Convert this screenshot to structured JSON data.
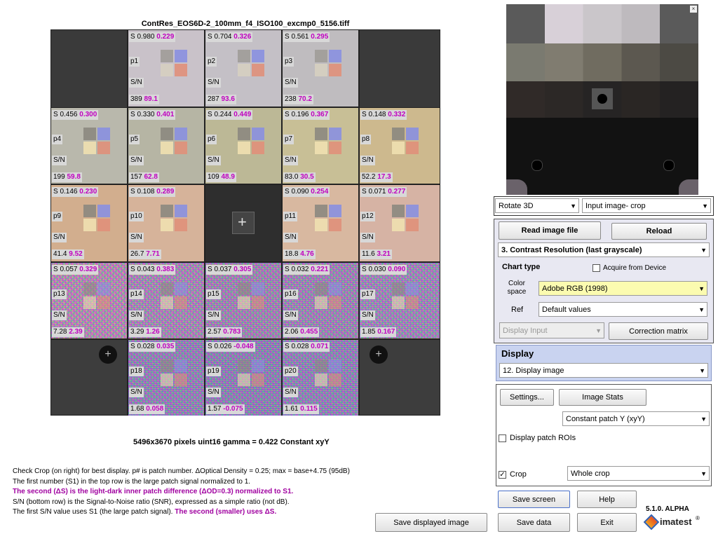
{
  "chart": {
    "title": "ContRes_EOS6D-2_100mm_f4_ISO100_excmp0_5156.tiff",
    "patches": [
      {
        "id": "p1",
        "s1": "S 0.980",
        "s2": "0.229",
        "sn1": "389",
        "sn2": "89.1",
        "col": 1,
        "row": 0,
        "bg": "#c9c2c9"
      },
      {
        "id": "p2",
        "s1": "S 0.704",
        "s2": "0.326",
        "sn1": "287",
        "sn2": "93.6",
        "col": 2,
        "row": 0,
        "bg": "#c4c0c6"
      },
      {
        "id": "p3",
        "s1": "S 0.561",
        "s2": "0.295",
        "sn1": "238",
        "sn2": "70.2",
        "col": 3,
        "row": 0,
        "bg": "#bfbcbf"
      },
      {
        "id": "p4",
        "s1": "S 0.456",
        "s2": "0.300",
        "sn1": "199",
        "sn2": "59.8",
        "col": 0,
        "row": 1,
        "bg": "#b9b8ac"
      },
      {
        "id": "p5",
        "s1": "S 0.330",
        "s2": "0.401",
        "sn1": "157",
        "sn2": "62.8",
        "col": 1,
        "row": 1,
        "bg": "#b6b5a4"
      },
      {
        "id": "p6",
        "s1": "S 0.244",
        "s2": "0.449",
        "sn1": "109",
        "sn2": "48.9",
        "col": 2,
        "row": 1,
        "bg": "#bcb896"
      },
      {
        "id": "p7",
        "s1": "S 0.196",
        "s2": "0.367",
        "sn1": "83.0",
        "sn2": "30.5",
        "col": 3,
        "row": 1,
        "bg": "#c8bf96"
      },
      {
        "id": "p8",
        "s1": "S 0.148",
        "s2": "0.332",
        "sn1": "52.2",
        "sn2": "17.3",
        "col": 4,
        "row": 1,
        "bg": "#cdb98e"
      },
      {
        "id": "p9",
        "s1": "S 0.146",
        "s2": "0.230",
        "sn1": "41.4",
        "sn2": "9.52",
        "col": 0,
        "row": 2,
        "bg": "#d2ae8e"
      },
      {
        "id": "p10",
        "s1": "S 0.108",
        "s2": "0.289",
        "sn1": "26.7",
        "sn2": "7.71",
        "col": 1,
        "row": 2,
        "bg": "#d6b39a"
      },
      {
        "id": "p11",
        "s1": "S 0.090",
        "s2": "0.254",
        "sn1": "18.8",
        "sn2": "4.76",
        "col": 3,
        "row": 2,
        "bg": "#d8b8a0"
      },
      {
        "id": "p12",
        "s1": "S 0.071",
        "s2": "0.277",
        "sn1": "11.6",
        "sn2": "3.21",
        "col": 4,
        "row": 2,
        "bg": "#d6b3a4"
      },
      {
        "id": "p13",
        "s1": "S 0.057",
        "s2": "0.329",
        "sn1": "7.28",
        "sn2": "2.39",
        "col": 0,
        "row": 3,
        "bg": "#b88fb0"
      },
      {
        "id": "p14",
        "s1": "S 0.043",
        "s2": "0.383",
        "sn1": "3.29",
        "sn2": "1.26",
        "col": 1,
        "row": 3,
        "bg": "#a68ab4"
      },
      {
        "id": "p15",
        "s1": "S 0.037",
        "s2": "0.305",
        "sn1": "2.57",
        "sn2": "0.783",
        "col": 2,
        "row": 3,
        "bg": "#9c86b0"
      },
      {
        "id": "p16",
        "s1": "S 0.032",
        "s2": "0.221",
        "sn1": "2.06",
        "sn2": "0.455",
        "col": 3,
        "row": 3,
        "bg": "#9a86b4"
      },
      {
        "id": "p17",
        "s1": "S 0.030",
        "s2": "0.090",
        "sn1": "1.85",
        "sn2": "0.167",
        "col": 4,
        "row": 3,
        "bg": "#9a8ab8"
      },
      {
        "id": "p18",
        "s1": "S 0.028",
        "s2": "0.035",
        "sn1": "1.68",
        "sn2": "0.058",
        "col": 1,
        "row": 4,
        "bg": "#8a82b6"
      },
      {
        "id": "p19",
        "s1": "S 0.026",
        "s2": "-0.048",
        "sn1": "1.57",
        "sn2": "-0.075",
        "col": 2,
        "row": 4,
        "bg": "#8480b4"
      },
      {
        "id": "p20",
        "s1": "S 0.028",
        "s2": "0.071",
        "sn1": "1.61",
        "sn2": "0.115",
        "col": 3,
        "row": 4,
        "bg": "#8882b8"
      }
    ],
    "sn_label": "S/N"
  },
  "info_line": "5496x3670 pixels    uint16    gamma = 0.422    Constant xyY",
  "notes": {
    "line1": "Check Crop (on right) for best display. p# is patch number. ΔOptical Density = 0.25; max = base+4.75 (95dB)",
    "line2": "The first number (S1) in the top row is the large patch signal normalized to 1.",
    "line3": "The second (ΔS) is the light-dark inner patch difference (ΔOD=0.3) normalized to S1.",
    "line4": "S/N (bottom row) is the Signal-to-Noise ratio (SNR), expressed as a simple ratio (not dB).",
    "line5a": "The first S/N value uses S1 (the large patch signal). ",
    "line5b": "The second (smaller) uses ΔS."
  },
  "controls": {
    "rotate": "Rotate 3D",
    "input_crop": "Input image- crop",
    "read_image": "Read image file",
    "reload": "Reload",
    "chart_select": "3.  Contrast Resolution  (last grayscale)",
    "chart_type": "Chart type",
    "acquire": "Acquire from Device",
    "color_space_label": "Color space",
    "color_space": "Adobe RGB (1998)",
    "ref_label": "Ref",
    "ref_value": "Default values",
    "display_input": "Display Input",
    "correction_matrix": "Correction matrix",
    "display_header": "Display",
    "display_select": "12. Display image",
    "settings": "Settings...",
    "image_stats": "Image Stats",
    "patch_select": "Constant patch Y (xyY)",
    "display_rois": "Display patch ROIs",
    "crop_label": "Crop",
    "crop_select": "Whole crop",
    "save_screen": "Save screen",
    "help": "Help",
    "save_displayed": "Save displayed image",
    "save_data": "Save data",
    "exit": "Exit",
    "version": "5.1.0. ALPHA",
    "brand": "imatest"
  },
  "colors": {
    "magenta": "#c000c0",
    "display_bg": "#c9d3f0",
    "panel_bg": "#e9e9f4",
    "yellow_field": "#fbfbb0"
  }
}
